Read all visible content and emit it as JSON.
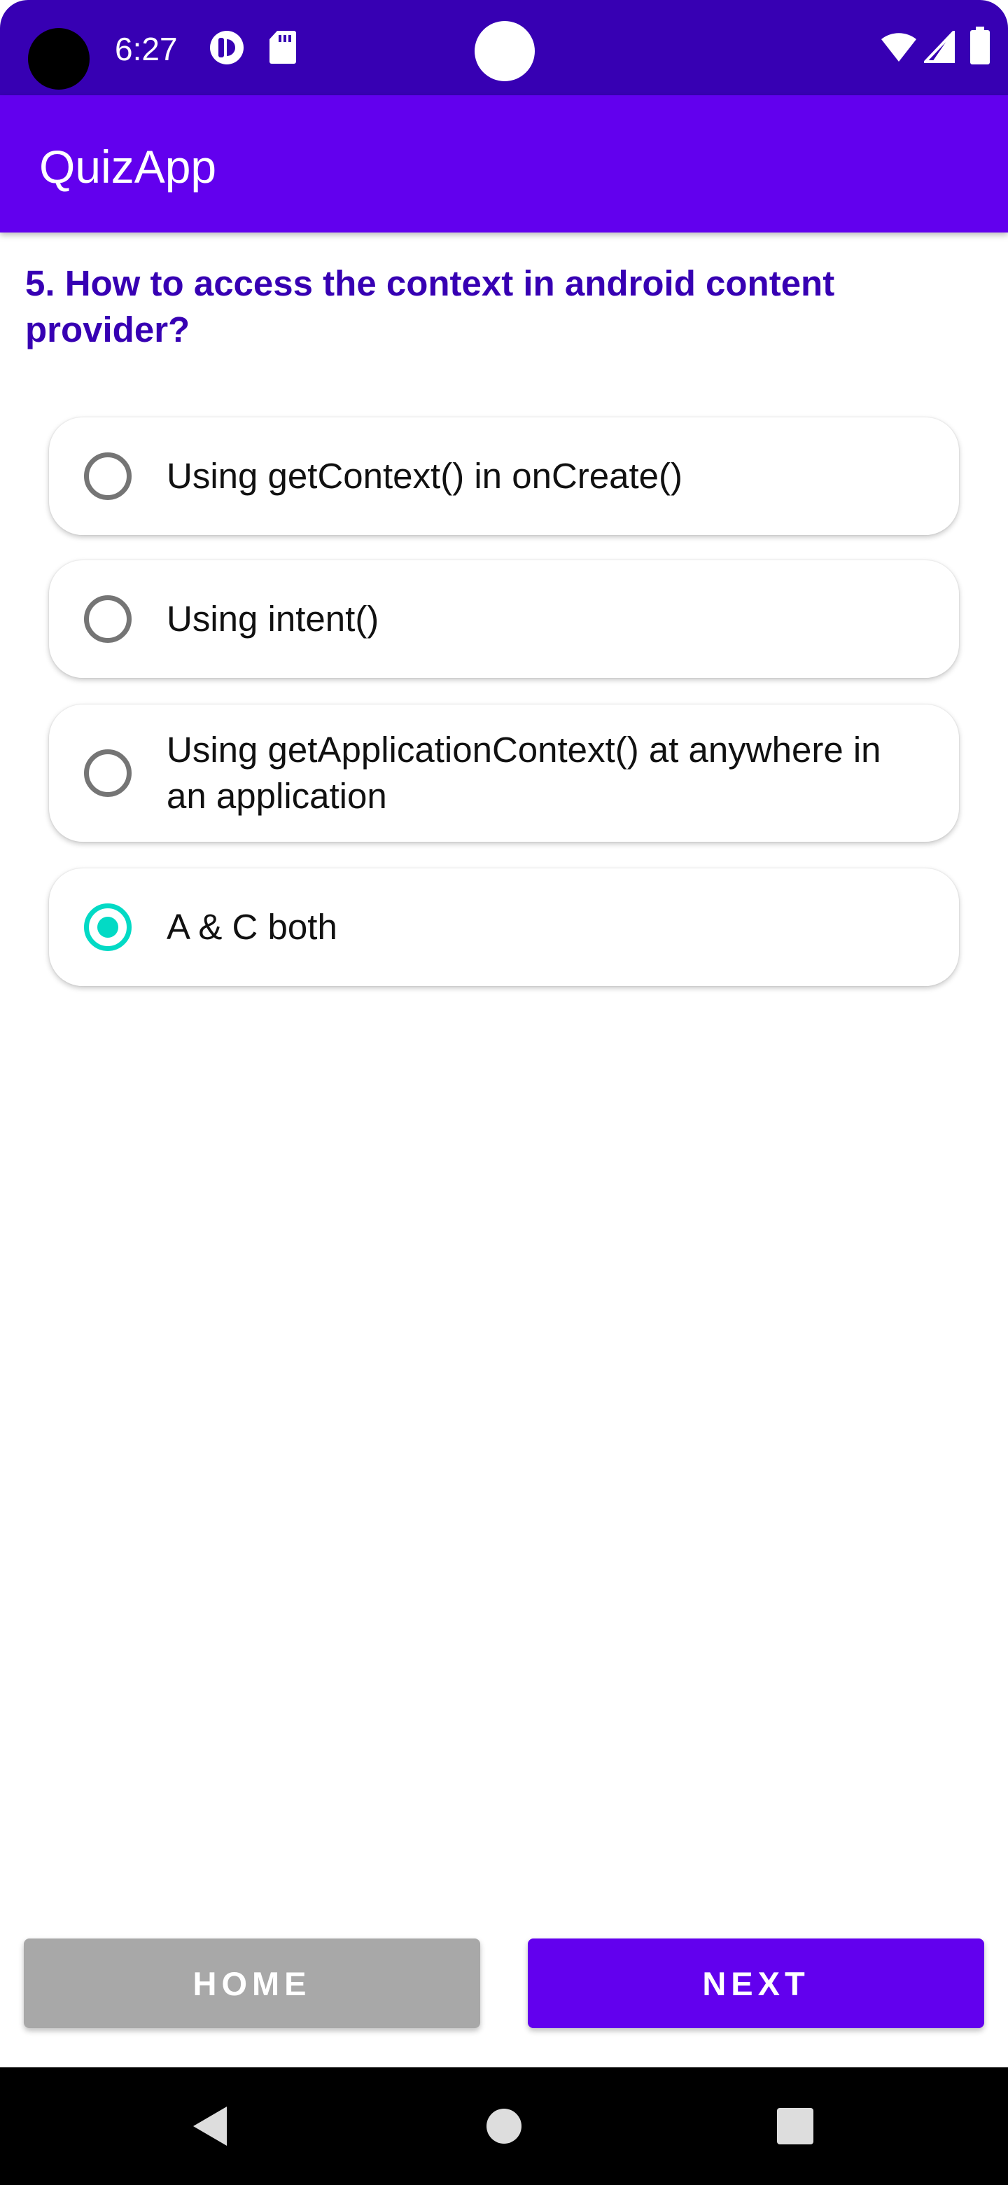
{
  "status_bar": {
    "time": "6:27",
    "icons": [
      "media-icon",
      "sd-card-icon",
      "wifi-icon",
      "signal-icon",
      "battery-icon"
    ]
  },
  "app_bar": {
    "title": "QuizApp"
  },
  "question": {
    "text": "5. How to access the context in android content provider?"
  },
  "options": [
    {
      "label": "Using getContext() in onCreate()",
      "selected": false
    },
    {
      "label": "Using intent()",
      "selected": false
    },
    {
      "label": "Using getApplicationContext() at anywhere in an application",
      "selected": false
    },
    {
      "label": "A & C both",
      "selected": true
    }
  ],
  "buttons": {
    "home_label": "HOME",
    "next_label": "NEXT"
  },
  "nav_bar": {
    "icons": [
      "back-icon",
      "home-icon",
      "recents-icon"
    ]
  },
  "colors": {
    "status_bar": "#3700b3",
    "app_bar": "#6200ee",
    "question_text": "#3700b3",
    "radio_selected": "#03dac5",
    "home_button": "#a8a8a8",
    "next_button": "#6200ee"
  }
}
